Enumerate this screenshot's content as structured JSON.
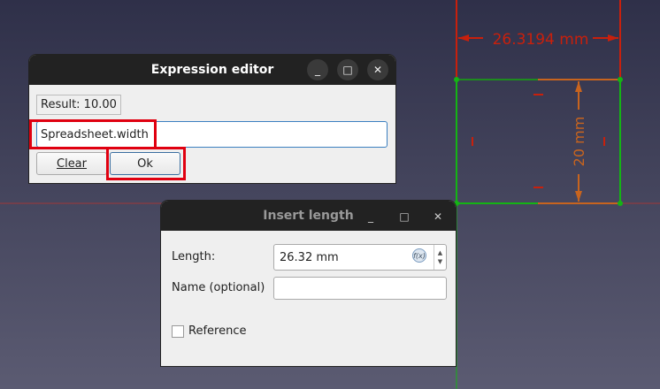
{
  "sketch": {
    "width_dimension": "26.3194 mm",
    "height_dimension": "20 mm",
    "colors": {
      "constraint": "#c8200c",
      "edge": "#14b414",
      "dimension_orange": "#c8641e"
    }
  },
  "expression_editor": {
    "title": "Expression editor",
    "result": "Result: 10.00",
    "expression_value": "Spreadsheet.width",
    "clear_label": "Clear",
    "ok_label": "Ok",
    "highlight_color": "#e00010"
  },
  "insert_length": {
    "title": "Insert length",
    "length_label": "Length:",
    "length_value": "26.32 mm",
    "name_label": "Name (optional)",
    "name_value": "",
    "reference_label": "Reference",
    "reference_checked": false
  }
}
